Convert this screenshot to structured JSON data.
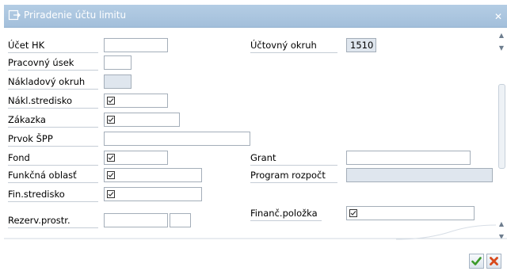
{
  "window": {
    "title": "Priradenie účtu limitu",
    "close_icon": "close-icon"
  },
  "form": {
    "ucet_hk": {
      "label": "Účet HK",
      "value": ""
    },
    "pracovny_usek": {
      "label": "Pracovný úsek",
      "value": ""
    },
    "nakladovy_okruh": {
      "label": "Nákladový okruh",
      "value": ""
    },
    "nakl_stredisko": {
      "label": "Nákl.stredisko",
      "value": ""
    },
    "zakazka": {
      "label": "Zákazka",
      "value": ""
    },
    "prvok_spp": {
      "label": "Prvok ŠPP",
      "value": ""
    },
    "fond": {
      "label": "Fond",
      "value": ""
    },
    "funkcna_oblast": {
      "label": "Funkčná oblasť",
      "value": ""
    },
    "fin_stredisko": {
      "label": "Fin.stredisko",
      "value": ""
    },
    "rezerv_prostr": {
      "label": "Rezerv.prostr.",
      "value": "",
      "item_value": ""
    },
    "uctovny_okruh": {
      "label": "Účtovný okruh",
      "value": "1510"
    },
    "grant": {
      "label": "Grant",
      "value": ""
    },
    "program_rozpocet": {
      "label": "Program rozpočt",
      "value": ""
    },
    "financ_polozka": {
      "label": "Finanč.položka",
      "value": ""
    }
  },
  "buttons": {
    "confirm_icon": "checkmark-icon",
    "cancel_icon": "cancel-icon"
  },
  "colors": {
    "titlebar": "#a9c4df",
    "readonly_field": "#dfe6ee",
    "confirm": "#3c9a2a",
    "cancel": "#d84a1c"
  }
}
